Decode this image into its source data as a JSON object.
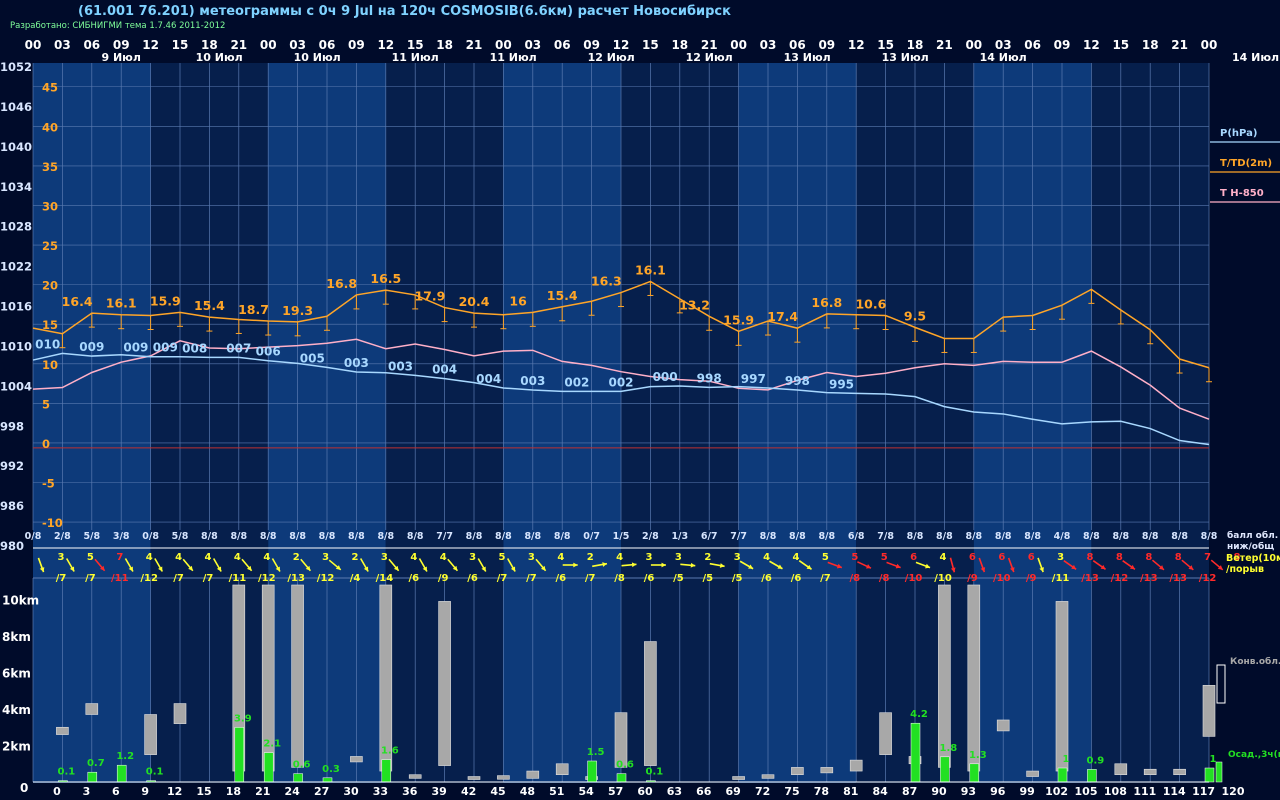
{
  "title": "(61.001 76.201) метеограммы с  0ч 9 Jul на 120ч COSMOSIB(6.6км) расчет Новосибирск",
  "credit": "Разработано: СИБНИГМИ тема 1.7.46 2011-2012",
  "colors": {
    "background": "#000b2a",
    "band_light": "#0d3a7a",
    "band_dark": "#061f4c",
    "grid": "#5a7ab0",
    "pressure": "#a8d8ff",
    "temperature": "#ffa528",
    "t850": "#ffb0c8",
    "zero_line": "#c03030",
    "precip": "#22e022",
    "cloud": "#a8a8a8",
    "wind_yellow": "#ffff30",
    "wind_red": "#ff2a2a"
  },
  "header": {
    "hours": [
      "00",
      "03",
      "06",
      "09",
      "12",
      "15",
      "18",
      "21",
      "00",
      "03",
      "06",
      "09",
      "12",
      "15",
      "18",
      "21",
      "00",
      "03",
      "06",
      "09",
      "12",
      "15",
      "18",
      "21",
      "00",
      "03",
      "06",
      "09",
      "12",
      "15",
      "18",
      "21",
      "00",
      "03",
      "06",
      "09",
      "12",
      "15",
      "18",
      "21",
      "00"
    ],
    "dates": [
      "9 Июл",
      "10 Июл",
      "10 Июл",
      "11 Июл",
      "11 Июл",
      "12 Июл",
      "12 Июл",
      "13 Июл",
      "13 Июл",
      "14 Июл"
    ],
    "right_date": "14 Июл"
  },
  "legend": {
    "pressure": "P(hPa)",
    "temperature": "T/TD(2m)",
    "t850": "T H-850",
    "cloud_fraction": [
      "балл обл.",
      "ниж/общ"
    ],
    "wind": [
      "Ветер(10м)",
      "/порыв"
    ],
    "convective_cloud": "Конв.обл.",
    "precip": "Осад.,3ч(мм)"
  },
  "chart_data": {
    "type": "meteogram",
    "lead_hours": [
      0,
      3,
      6,
      9,
      12,
      15,
      18,
      21,
      24,
      27,
      30,
      33,
      36,
      39,
      42,
      45,
      48,
      51,
      54,
      57,
      60,
      63,
      66,
      69,
      72,
      75,
      78,
      81,
      84,
      87,
      90,
      93,
      96,
      99,
      102,
      105,
      108,
      111,
      114,
      117,
      120
    ],
    "x_axis_labels": [
      "0",
      "3",
      "6",
      "9",
      "12",
      "15",
      "18",
      "21",
      "24",
      "27",
      "30",
      "33",
      "36",
      "39",
      "42",
      "45",
      "48",
      "51",
      "54",
      "57",
      "60",
      "63",
      "66",
      "69",
      "72",
      "75",
      "78",
      "81",
      "84",
      "87",
      "90",
      "93",
      "96",
      "99",
      "102",
      "105",
      "108",
      "111",
      "114",
      "117",
      "120"
    ],
    "pressure_axis": {
      "ticks": [
        "1052",
        "1046",
        "1040",
        "1034",
        "1028",
        "1022",
        "1016",
        "1010",
        "1004",
        "998",
        "992",
        "986",
        "980"
      ],
      "range": [
        980,
        1052
      ]
    },
    "temperature_axis": {
      "ticks": [
        "45",
        "40",
        "35",
        "30",
        "25",
        "20",
        "15",
        "10",
        "5",
        "0",
        "-5",
        "-10"
      ],
      "range": [
        -11,
        48
      ]
    },
    "pressure_hpa": [
      1007.8,
      1008.8,
      1008.4,
      1008.6,
      1008.3,
      1008.3,
      1008.2,
      1008.2,
      1007.7,
      1007.3,
      1006.7,
      1006.0,
      1005.9,
      1005.5,
      1005.0,
      1004.4,
      1003.6,
      1003.3,
      1003.1,
      1003.1,
      1003.1,
      1003.8,
      1003.9,
      1003.7,
      1003.8,
      1003.6,
      1003.3,
      1002.9,
      1002.8,
      1002.7,
      1002.3,
      1000.8,
      1000.0,
      999.7,
      998.9,
      998.2,
      998.5,
      998.6,
      997.5,
      995.7,
      995.1
    ],
    "pressure_labels": [
      {
        "hour": 3,
        "text": "010"
      },
      {
        "hour": 12,
        "text": "009"
      },
      {
        "hour": 21,
        "text": "009"
      },
      {
        "hour": 27,
        "text": "009"
      },
      {
        "hour": 33,
        "text": "008"
      },
      {
        "hour": 42,
        "text": "007"
      },
      {
        "hour": 48,
        "text": "006"
      },
      {
        "hour": 57,
        "text": "005"
      },
      {
        "hour": 66,
        "text": "003"
      },
      {
        "hour": 75,
        "text": "003"
      },
      {
        "hour": 84,
        "text": "004"
      },
      {
        "hour": 93,
        "text": "004"
      },
      {
        "hour": 102,
        "text": "003"
      },
      {
        "hour": 111,
        "text": "002"
      },
      {
        "hour": 120,
        "text": "002"
      },
      {
        "hour": 129,
        "text": "000"
      },
      {
        "hour": 138,
        "text": "998"
      },
      {
        "hour": 147,
        "text": "997"
      },
      {
        "hour": 156,
        "text": "998"
      },
      {
        "hour": 165,
        "text": "995"
      }
    ],
    "temperature_c": [
      14.5,
      13.8,
      16.4,
      16.2,
      16.1,
      16.5,
      15.9,
      15.6,
      15.4,
      15.3,
      16.0,
      18.7,
      19.3,
      18.7,
      17.1,
      16.4,
      16.2,
      16.5,
      17.2,
      17.9,
      19.0,
      20.4,
      18.2,
      16.0,
      14.1,
      15.4,
      14.5,
      16.3,
      16.2,
      16.1,
      14.6,
      13.2,
      13.2,
      15.9,
      16.1,
      17.4,
      19.4,
      16.8,
      14.3,
      10.6,
      9.5
    ],
    "temperature_labels": [
      {
        "hour": 9,
        "text": "16.4"
      },
      {
        "hour": 18,
        "text": "16.1"
      },
      {
        "hour": 27,
        "text": "15.9"
      },
      {
        "hour": 36,
        "text": "15.4"
      },
      {
        "hour": 45,
        "text": "18.7"
      },
      {
        "hour": 54,
        "text": "19.3"
      },
      {
        "hour": 63,
        "text": "16.8"
      },
      {
        "hour": 72,
        "text": "16.5"
      },
      {
        "hour": 81,
        "text": "17.9"
      },
      {
        "hour": 90,
        "text": "20.4"
      },
      {
        "hour": 99,
        "text": "16"
      },
      {
        "hour": 108,
        "text": "15.4"
      },
      {
        "hour": 117,
        "text": "16.3"
      },
      {
        "hour": 126,
        "text": "16.1"
      },
      {
        "hour": 135,
        "text": "13.2"
      },
      {
        "hour": 144,
        "text": "15.9"
      },
      {
        "hour": 153,
        "text": "17.4"
      },
      {
        "hour": 162,
        "text": "16.8"
      },
      {
        "hour": 171,
        "text": "10.6"
      },
      {
        "hour": 180,
        "text": "9.5"
      }
    ],
    "t850_c": [
      6.8,
      7.0,
      8.9,
      10.2,
      11.0,
      12.9,
      12.0,
      11.9,
      12.1,
      12.3,
      12.6,
      13.1,
      11.9,
      12.5,
      11.8,
      11.0,
      11.6,
      11.7,
      10.3,
      9.8,
      9.0,
      8.4,
      8.0,
      7.8,
      6.9,
      6.7,
      7.9,
      8.9,
      8.4,
      8.8,
      9.5,
      10.0,
      9.8,
      10.3,
      10.2,
      10.2,
      11.6,
      9.6,
      7.3,
      4.4,
      3.0
    ],
    "cloud_fraction": [
      "0/8",
      "2/8",
      "5/8",
      "3/8",
      "0/8",
      "5/8",
      "8/8",
      "8/8",
      "8/8",
      "8/8",
      "8/8",
      "8/8",
      "8/8",
      "8/8",
      "7/7",
      "8/8",
      "8/8",
      "8/8",
      "8/8",
      "0/7",
      "1/5",
      "2/8",
      "1/3",
      "6/7",
      "7/7",
      "8/8",
      "8/8",
      "8/8",
      "6/8",
      "7/8",
      "8/8",
      "8/8",
      "8/8",
      "8/8",
      "8/8",
      "4/8",
      "8/8",
      "8/8",
      "8/8",
      "8/8",
      "8/8"
    ],
    "wind_speed": [
      "3",
      "5",
      "7",
      "4",
      "4",
      "4",
      "4",
      "4",
      "2",
      "3",
      "2",
      "3",
      "4",
      "4",
      "3",
      "5",
      "3",
      "4",
      "2",
      "4",
      "3",
      "3",
      "2",
      "3",
      "4",
      "4",
      "5",
      "5",
      "5",
      "6",
      "4",
      "6",
      "6",
      "6",
      "3",
      "8",
      "8",
      "8",
      "8",
      "7",
      "8"
    ],
    "wind_gust": [
      "/7",
      "/7",
      "/11",
      "/12",
      "/7",
      "/7",
      "/11",
      "/12",
      "/13",
      "/12",
      "/4",
      "/14",
      "/6",
      "/9",
      "/6",
      "/7",
      "/7",
      "/6",
      "/7",
      "/8",
      "/6",
      "/5",
      "/5",
      "/5",
      "/6",
      "/6",
      "/7",
      "/8",
      "/8",
      "/10",
      "/10",
      "/9",
      "/10",
      "/9",
      "/11",
      "/13",
      "/12",
      "/13",
      "/13",
      "/12"
    ],
    "wind_dir_deg": [
      160,
      150,
      140,
      150,
      150,
      140,
      150,
      140,
      150,
      140,
      130,
      150,
      140,
      150,
      140,
      150,
      150,
      140,
      90,
      80,
      85,
      90,
      95,
      100,
      120,
      120,
      125,
      110,
      115,
      110,
      110,
      165,
      160,
      160,
      160,
      125,
      125,
      125,
      130,
      130,
      130
    ],
    "wind_color": [
      "y",
      "y",
      "r",
      "y",
      "y",
      "y",
      "y",
      "y",
      "y",
      "y",
      "y",
      "y",
      "y",
      "y",
      "y",
      "y",
      "y",
      "y",
      "y",
      "y",
      "y",
      "y",
      "y",
      "y",
      "y",
      "y",
      "y",
      "r",
      "r",
      "r",
      "y",
      "r",
      "r",
      "r",
      "y",
      "r",
      "r",
      "r",
      "r",
      "r",
      "r"
    ],
    "precip_mm": [
      0,
      0.1,
      0.7,
      1.2,
      0.1,
      0,
      0,
      3.9,
      2.1,
      0.6,
      0.3,
      0,
      1.6,
      0,
      0,
      0,
      0,
      0,
      0,
      1.5,
      0.6,
      0.1,
      0,
      0,
      0,
      0,
      0,
      0,
      0,
      0,
      4.2,
      1.8,
      1.3,
      0,
      0,
      1,
      0.9,
      0,
      0,
      0,
      1
    ],
    "precip_labels": [
      {
        "hour": 3,
        "text": "0.1"
      },
      {
        "hour": 6,
        "text": "0.7"
      },
      {
        "hour": 9,
        "text": "1.2"
      },
      {
        "hour": 12,
        "text": "0.1"
      },
      {
        "hour": 21,
        "text": "3.9"
      },
      {
        "hour": 24,
        "text": "2.1"
      },
      {
        "hour": 27,
        "text": "0.6"
      },
      {
        "hour": 30,
        "text": "0.3"
      },
      {
        "hour": 36,
        "text": "1.6"
      },
      {
        "hour": 57,
        "text": "1.5"
      },
      {
        "hour": 60,
        "text": "0.6"
      },
      {
        "hour": 63,
        "text": "0.1"
      },
      {
        "hour": 90,
        "text": "4.2"
      },
      {
        "hour": 93,
        "text": "1.8"
      },
      {
        "hour": 96,
        "text": "1.3"
      },
      {
        "hour": 105,
        "text": "1"
      },
      {
        "hour": 108,
        "text": "0.9"
      },
      {
        "hour": 120,
        "text": "1"
      }
    ],
    "cloud_axis": {
      "ticks": [
        "10km",
        "8km",
        "6km",
        "4km",
        "2km",
        "0"
      ],
      "range_km": [
        0,
        12
      ]
    },
    "convective_cloud_km": [
      {
        "hour": 3,
        "base": 2.6,
        "top": 3.0
      },
      {
        "hour": 6,
        "base": 3.7,
        "top": 4.3
      },
      {
        "hour": 12,
        "base": 1.5,
        "top": 3.7
      },
      {
        "hour": 15,
        "base": 3.2,
        "top": 4.3
      },
      {
        "hour": 21,
        "base": 0.6,
        "top": 10.8
      },
      {
        "hour": 24,
        "base": 0.6,
        "top": 10.8
      },
      {
        "hour": 27,
        "base": 0.8,
        "top": 10.8
      },
      {
        "hour": 33,
        "base": 1.1,
        "top": 1.4
      },
      {
        "hour": 36,
        "base": 0.6,
        "top": 10.8
      },
      {
        "hour": 39,
        "base": 0.2,
        "top": 0.4
      },
      {
        "hour": 42,
        "base": 0.9,
        "top": 9.9
      },
      {
        "hour": 45,
        "base": 0.15,
        "top": 0.3
      },
      {
        "hour": 48,
        "base": 0.15,
        "top": 0.35
      },
      {
        "hour": 51,
        "base": 0.2,
        "top": 0.6
      },
      {
        "hour": 54,
        "base": 0.4,
        "top": 1.0
      },
      {
        "hour": 57,
        "base": 0.15,
        "top": 0.3
      },
      {
        "hour": 60,
        "base": 0.8,
        "top": 3.8
      },
      {
        "hour": 63,
        "base": 0.9,
        "top": 7.7
      },
      {
        "hour": 72,
        "base": 0.15,
        "top": 0.3
      },
      {
        "hour": 75,
        "base": 0.2,
        "top": 0.4
      },
      {
        "hour": 78,
        "base": 0.4,
        "top": 0.8
      },
      {
        "hour": 81,
        "base": 0.5,
        "top": 0.8
      },
      {
        "hour": 84,
        "base": 0.6,
        "top": 1.2
      },
      {
        "hour": 87,
        "base": 1.5,
        "top": 3.8
      },
      {
        "hour": 90,
        "base": 1.0,
        "top": 1.4
      },
      {
        "hour": 93,
        "base": 0.8,
        "top": 10.8
      },
      {
        "hour": 96,
        "base": 0.6,
        "top": 10.8
      },
      {
        "hour": 99,
        "base": 2.8,
        "top": 3.4
      },
      {
        "hour": 102,
        "base": 0.3,
        "top": 0.6
      },
      {
        "hour": 105,
        "base": 0.6,
        "top": 9.9
      },
      {
        "hour": 111,
        "base": 0.4,
        "top": 1.0
      },
      {
        "hour": 114,
        "base": 0.4,
        "top": 0.7
      },
      {
        "hour": 117,
        "base": 0.4,
        "top": 0.7
      },
      {
        "hour": 120,
        "base": 2.5,
        "top": 5.3
      }
    ]
  }
}
